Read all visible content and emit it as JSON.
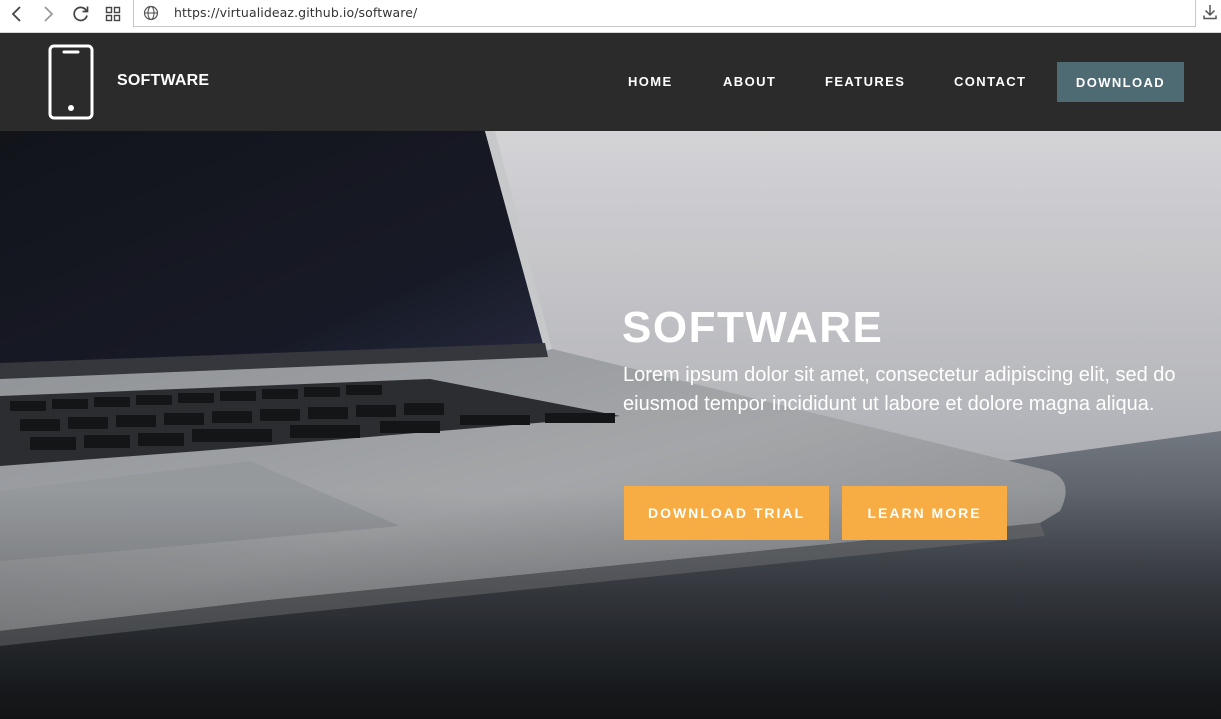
{
  "browser": {
    "url": "https://virtualideaz.github.io/software/"
  },
  "header": {
    "brand": "SOFTWARE",
    "nav": {
      "home": "HOME",
      "about": "ABOUT",
      "features": "FEATURES",
      "contact": "CONTACT",
      "download": "DOWNLOAD"
    }
  },
  "hero": {
    "title": "SOFTWARE",
    "text": "Lorem ipsum dolor sit amet, consectetur adipiscing elit, sed do eiusmod tempor incididunt ut labore et dolore magna aliqua.",
    "primary_button": "DOWNLOAD TRIAL",
    "secondary_button": "LEARN MORE"
  },
  "colors": {
    "header_bg": "#2b2b2b",
    "download_nav_bg": "#4e6a72",
    "cta_bg": "#f7ad43"
  },
  "icons": [
    "back-icon",
    "forward-icon",
    "reload-icon",
    "apps-grid-icon",
    "globe-icon",
    "download-icon",
    "smartphone-icon"
  ]
}
